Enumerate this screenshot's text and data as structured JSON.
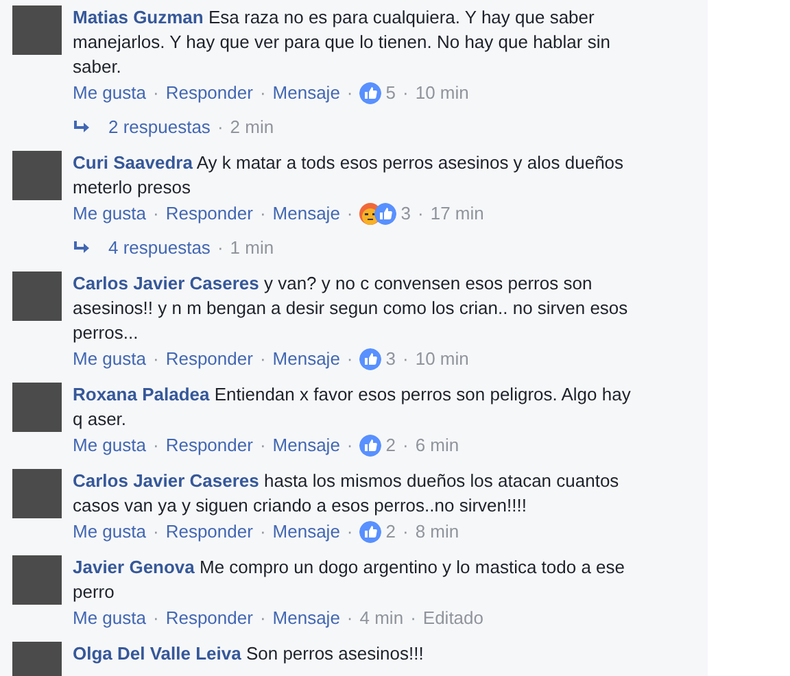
{
  "separator": "·",
  "comments": [
    {
      "author": "Matias Guzman",
      "text": "Esa raza no es para cualquiera. Y hay que saber manejarlos. Y hay que ver para que lo tienen. No hay que hablar sin saber.",
      "actions": [
        "Me gusta",
        "Responder",
        "Mensaje"
      ],
      "reactions": [
        {
          "kind": "like"
        }
      ],
      "reaction_count": "5",
      "time": "10 min",
      "replies": {
        "label": "2 respuestas",
        "time": "2 min"
      }
    },
    {
      "author": "Curi Saavedra",
      "text": "Ay k matar a tods esos perros asesinos y alos dueños meterlo presos",
      "actions": [
        "Me gusta",
        "Responder",
        "Mensaje"
      ],
      "reactions": [
        {
          "kind": "angry"
        },
        {
          "kind": "like"
        }
      ],
      "reaction_count": "3",
      "time": "17 min",
      "replies": {
        "label": "4 respuestas",
        "time": "1 min"
      }
    },
    {
      "author": "Carlos Javier Caseres",
      "text": "y van? y no c convensen esos perros son asesinos!! y n m bengan a desir segun como los crian.. no sirven esos perros...",
      "actions": [
        "Me gusta",
        "Responder",
        "Mensaje"
      ],
      "reactions": [
        {
          "kind": "like"
        }
      ],
      "reaction_count": "3",
      "time": "10 min"
    },
    {
      "author": "Roxana Paladea",
      "text": "Entiendan x favor esos perros son peligros. Algo hay q aser.",
      "actions": [
        "Me gusta",
        "Responder",
        "Mensaje"
      ],
      "reactions": [
        {
          "kind": "like"
        }
      ],
      "reaction_count": "2",
      "time": "6 min"
    },
    {
      "author": "Carlos Javier Caseres",
      "text": "hasta los mismos dueños los atacan cuantos casos van ya y siguen criando a esos perros..no sirven!!!!",
      "actions": [
        "Me gusta",
        "Responder",
        "Mensaje"
      ],
      "reactions": [
        {
          "kind": "like"
        }
      ],
      "reaction_count": "2",
      "time": "8 min"
    },
    {
      "author": "Javier Genova",
      "text": "Me compro un dogo argentino y lo mastica todo a ese perro",
      "actions": [
        "Me gusta",
        "Responder",
        "Mensaje"
      ],
      "time": "4 min",
      "edited": "Editado"
    },
    {
      "author": "Olga Del Valle Leiva",
      "text": "Son perros asesinos!!!"
    }
  ]
}
